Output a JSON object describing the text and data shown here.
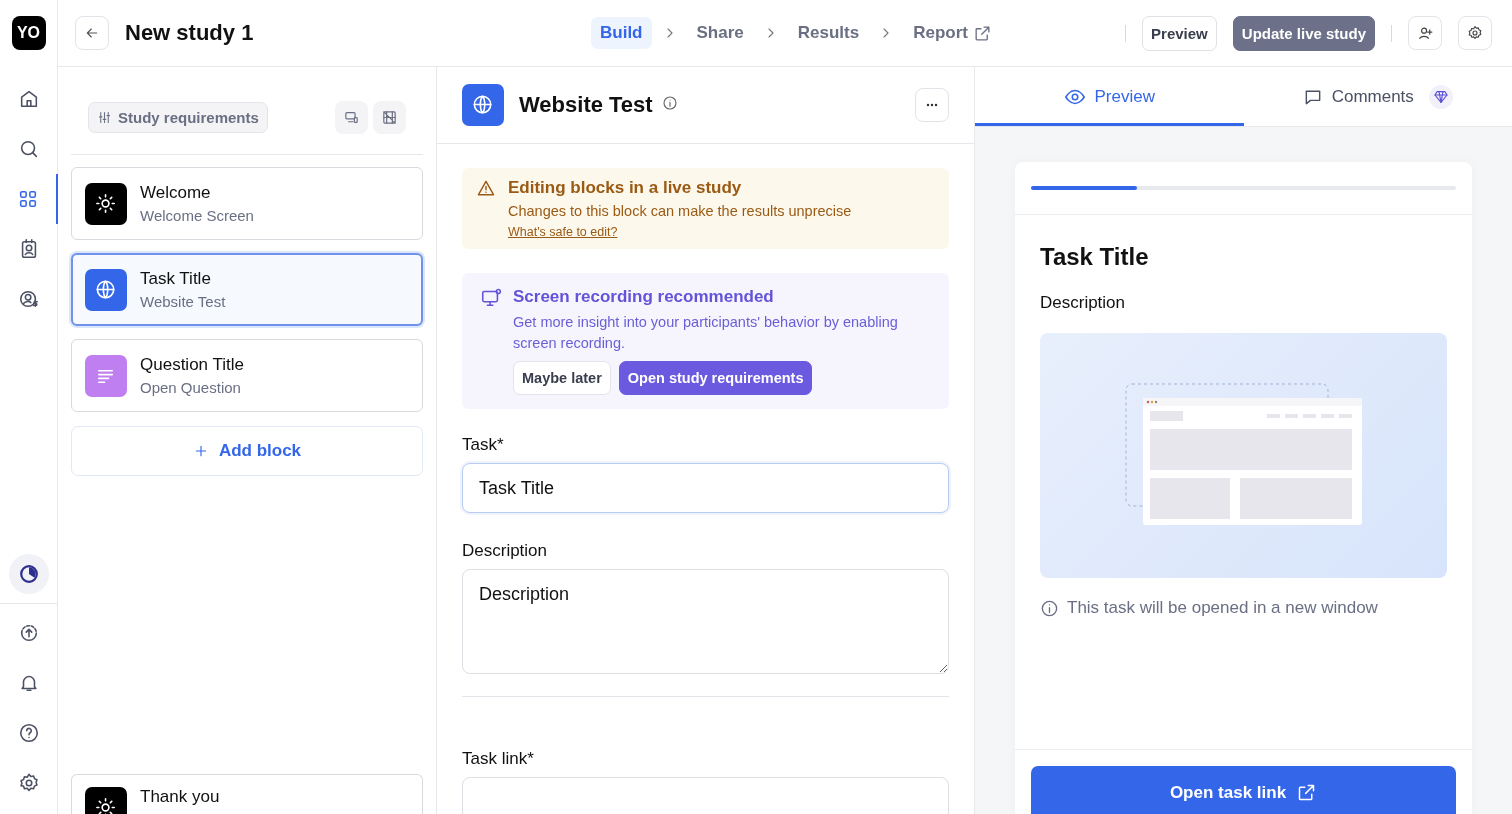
{
  "rail": {
    "logo": "YO",
    "items": [
      {
        "kind": "home",
        "selected": false
      },
      {
        "kind": "search",
        "selected": false
      },
      {
        "kind": "blocks",
        "selected": true
      },
      {
        "kind": "participants",
        "selected": false
      },
      {
        "kind": "billing",
        "selected": false
      }
    ],
    "bottom_items": [
      {
        "kind": "progress",
        "selected": false
      },
      {
        "kind": "upload",
        "selected": false
      },
      {
        "kind": "bell",
        "selected": false
      },
      {
        "kind": "help",
        "selected": false
      },
      {
        "kind": "settings",
        "selected": false
      }
    ]
  },
  "header": {
    "title": "New study 1",
    "steps": [
      {
        "label": "Build",
        "selected": true,
        "external": false
      },
      {
        "label": "Share",
        "selected": false,
        "external": false
      },
      {
        "label": "Results",
        "selected": false,
        "external": false
      },
      {
        "label": "Report",
        "selected": false,
        "external": true
      }
    ],
    "buttons": [
      {
        "label": "Preview",
        "kind": "outline"
      },
      {
        "label": "Update live study",
        "kind": "filled"
      }
    ]
  },
  "blocks": {
    "requirements_button": "Study requirements",
    "items": [
      {
        "title": "Welcome",
        "subtitle": "Welcome Screen",
        "kind": "welcome",
        "selected": false
      },
      {
        "title": "Task Title",
        "subtitle": "Website Test",
        "kind": "website",
        "selected": true
      },
      {
        "title": "Question Title",
        "subtitle": "Open Question",
        "kind": "question",
        "selected": false
      }
    ],
    "add_button": "Add block",
    "footer_block": {
      "title": "Thank you",
      "kind": "welcome"
    }
  },
  "editor": {
    "title": "Website Test",
    "kind": "website",
    "warning": {
      "title": "Editing blocks in a live study",
      "text": "Changes to this block can make the results unprecise",
      "link": "What's safe to edit?"
    },
    "recommendation": {
      "title": "Screen recording recommended",
      "text": "Get more insight into your participants' behavior by enabling screen recording.",
      "buttons": [
        {
          "label": "Maybe later",
          "kind": "outline"
        },
        {
          "label": "Open study requirements",
          "kind": "filled"
        }
      ]
    },
    "fields": [
      {
        "label": "Task*",
        "value": "Task Title",
        "kind": "input",
        "focused": true
      },
      {
        "label": "Description",
        "value": "Description",
        "kind": "textarea",
        "focused": false
      },
      {
        "label": "Task link*",
        "kind": "input",
        "focused": false
      }
    ]
  },
  "preview": {
    "tabs": [
      {
        "label": "Preview",
        "selected": true,
        "kind": "preview"
      },
      {
        "label": "Comments",
        "selected": false,
        "kind": "comments",
        "premium": true
      }
    ],
    "progress": {
      "level": 0.25
    },
    "title": "Task Title",
    "description": "Description",
    "note": "This task will be opened in a new window",
    "button": "Open task link"
  }
}
